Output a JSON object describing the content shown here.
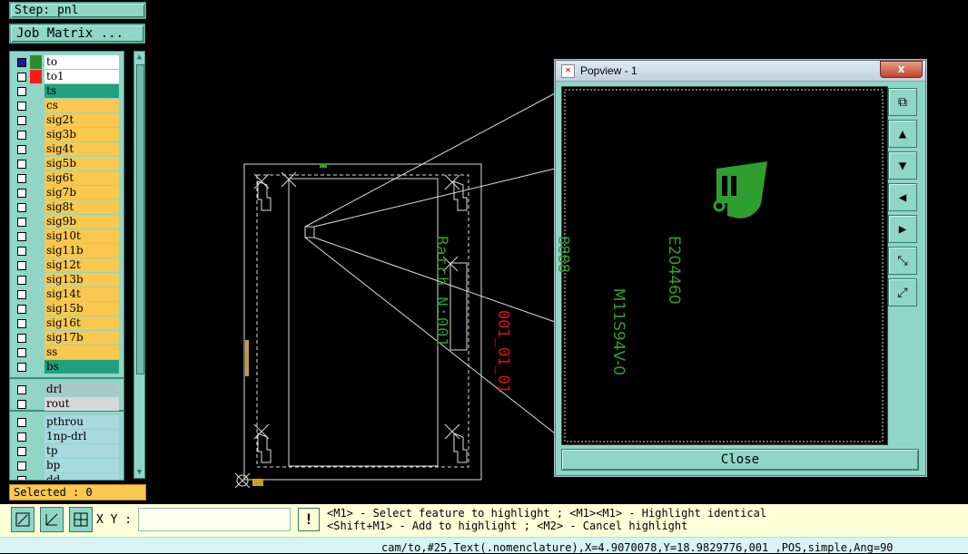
{
  "step_label": "Step: pnl",
  "job_matrix_label": "Job Matrix ...",
  "layers_group1": [
    {
      "name": "to",
      "color": "#ffffff",
      "swatch": "#2e8b2e",
      "active": true
    },
    {
      "name": "to1",
      "color": "#ffffff",
      "swatch": "#ff1a1a"
    },
    {
      "name": "ts",
      "color": "#20a080",
      "swatch": ""
    },
    {
      "name": "cs",
      "color": "#f9c84f",
      "swatch": ""
    },
    {
      "name": "sig2t",
      "color": "#f9c84f",
      "swatch": ""
    },
    {
      "name": "sig3b",
      "color": "#f9c84f",
      "swatch": ""
    },
    {
      "name": "sig4t",
      "color": "#f9c84f",
      "swatch": ""
    },
    {
      "name": "sig5b",
      "color": "#f9c84f",
      "swatch": ""
    },
    {
      "name": "sig6t",
      "color": "#f9c84f",
      "swatch": ""
    },
    {
      "name": "sig7b",
      "color": "#f9c84f",
      "swatch": ""
    },
    {
      "name": "sig8t",
      "color": "#f9c84f",
      "swatch": ""
    },
    {
      "name": "sig9b",
      "color": "#f9c84f",
      "swatch": ""
    },
    {
      "name": "sig10t",
      "color": "#f9c84f",
      "swatch": ""
    },
    {
      "name": "sig11b",
      "color": "#f9c84f",
      "swatch": ""
    },
    {
      "name": "sig12t",
      "color": "#f9c84f",
      "swatch": ""
    },
    {
      "name": "sig13b",
      "color": "#f9c84f",
      "swatch": ""
    },
    {
      "name": "sig14t",
      "color": "#f9c84f",
      "swatch": ""
    },
    {
      "name": "sig15b",
      "color": "#f9c84f",
      "swatch": ""
    },
    {
      "name": "sig16t",
      "color": "#f9c84f",
      "swatch": ""
    },
    {
      "name": "sig17b",
      "color": "#f9c84f",
      "swatch": ""
    },
    {
      "name": "ss",
      "color": "#f9c84f",
      "swatch": ""
    },
    {
      "name": "bs",
      "color": "#20a080",
      "swatch": ""
    }
  ],
  "layers_group2": [
    {
      "name": "drl",
      "color": "#a8c8c8",
      "swatch": ""
    },
    {
      "name": "rout",
      "color": "#d8d8d8",
      "swatch": ""
    }
  ],
  "layers_group3": [
    {
      "name": "pthrou",
      "color": "#a8d8e0",
      "swatch": ""
    },
    {
      "name": "1np-drl",
      "color": "#a8d8e0",
      "swatch": ""
    },
    {
      "name": "tp",
      "color": "#a8d8e0",
      "swatch": ""
    },
    {
      "name": "bp",
      "color": "#a8d8e0",
      "swatch": ""
    },
    {
      "name": "dd",
      "color": "#a8d8e0",
      "swatch": ""
    }
  ],
  "selected_label": "Selected : 0",
  "xy_label": "X Y :",
  "xy_value": "",
  "hint_line1": "<M1> - Select feature to highlight ; <M1><M1> - Highlight identical",
  "hint_line2": "<Shift+M1> - Add to highlight ; <M2> - Cancel highlight",
  "status_text": "cam/to,#25,Text(.nomenclature),X=4.9070078,Y=18.9829776,001_,POS,simple,Ang=90",
  "popview": {
    "title": "Popview - 1",
    "close_x": "x",
    "close_button": "Close",
    "marking_lines": [
      "E204460",
      "M11S94V-0",
      "8888",
      "001_01_01",
      "Batch N:001"
    ],
    "colors": {
      "green": "#2e9e2e",
      "purple": "#b050e0",
      "red": "#e01010"
    }
  },
  "tool_icons": [
    "zoom-fit-icon",
    "measure-icon",
    "snap-grid-icon"
  ],
  "popview_tool_icons": [
    "copy-view-icon",
    "pan-up-icon",
    "pan-down-icon",
    "pan-left-icon",
    "pan-right-icon",
    "zoom-out-icon",
    "zoom-in-icon"
  ]
}
